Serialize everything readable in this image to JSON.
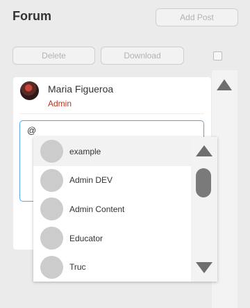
{
  "header": {
    "title": "Forum",
    "add_post_label": "Add Post"
  },
  "toolbar": {
    "delete_label": "Delete",
    "download_label": "Download",
    "select_all_checked": false
  },
  "post": {
    "author": {
      "name": "Maria Figueroa",
      "role": "Admin",
      "avatar_icon": "user-photo"
    },
    "editor": {
      "value": "@"
    }
  },
  "mention_dropdown": {
    "items": [
      {
        "label": "example",
        "avatar_icon": "default-avatar"
      },
      {
        "label": "Admin DEV",
        "avatar_icon": "default-avatar"
      },
      {
        "label": "Admin Content",
        "avatar_icon": "default-avatar"
      },
      {
        "label": "Educator",
        "avatar_icon": "default-avatar"
      },
      {
        "label": "Truc",
        "avatar_icon": "default-avatar"
      }
    ],
    "highlighted_index": 0
  },
  "colors": {
    "role_text": "#b5341f",
    "focus_border": "#5aa2e8"
  }
}
